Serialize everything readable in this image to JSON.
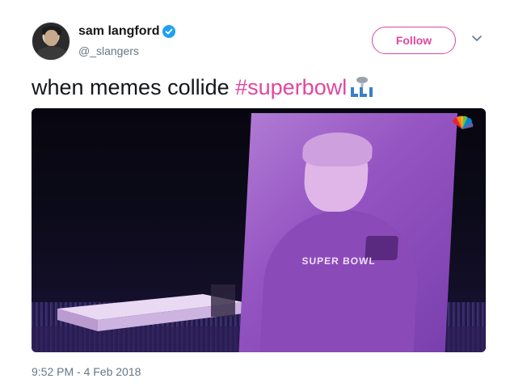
{
  "tweet": {
    "author": {
      "display_name": "sam langford",
      "handle": "@_slangers",
      "verified": true
    },
    "follow_label": "Follow",
    "text_prefix": "when memes collide ",
    "hashtag": "#superbowl",
    "hashtag_emoji": "superbowl-lii-logo",
    "media": {
      "type": "video-still",
      "broadcaster_icon": "nbc-peacock-icon",
      "screen_caption": "SUPER BOWL"
    },
    "timestamp": "9:52 PM - 4 Feb 2018"
  },
  "colors": {
    "accent": "#e0479e",
    "verified": "#1da1f2",
    "text": "#14171a",
    "muted": "#657786"
  }
}
